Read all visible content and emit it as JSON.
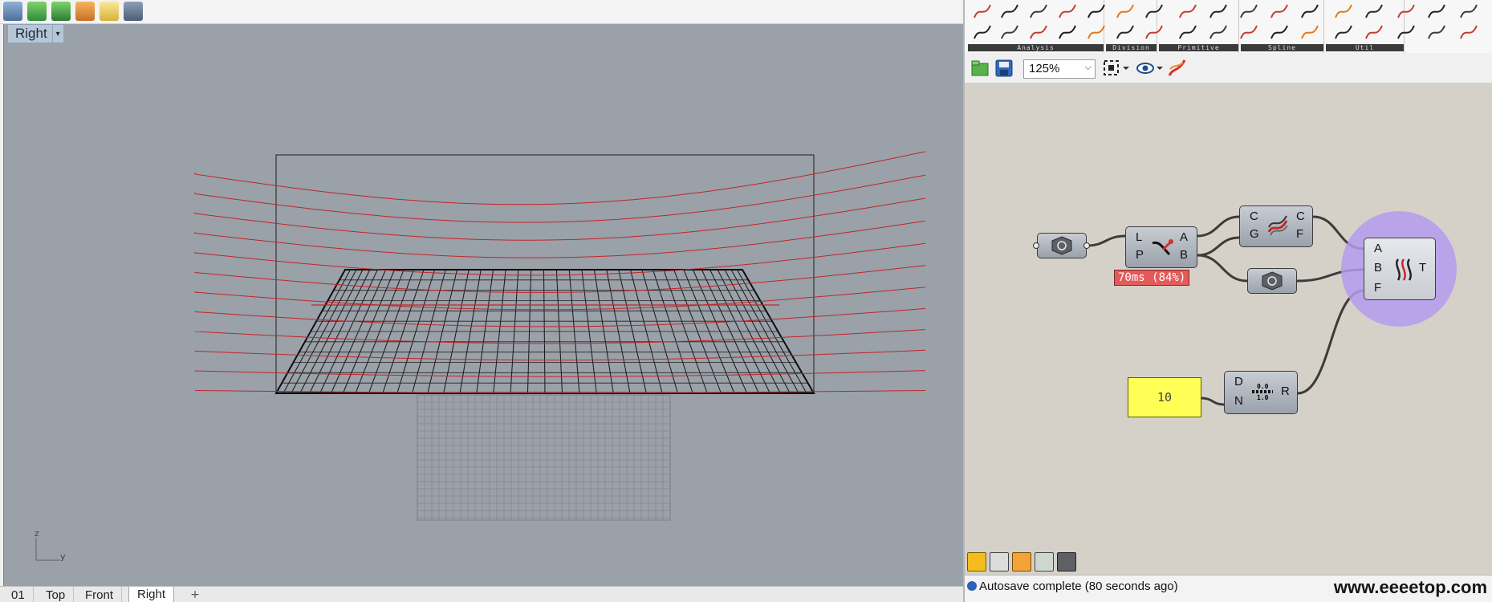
{
  "viewport": {
    "active_view": "Right",
    "axis_z": "z",
    "axis_y": "y"
  },
  "view_tabs": {
    "tabs": [
      "01",
      "Top",
      "Front",
      "Right"
    ],
    "active": "Right",
    "add": "+"
  },
  "grasshopper": {
    "ribbon_groups": [
      "Analysis",
      "Division",
      "Primitive",
      "Spline",
      "Util"
    ],
    "zoom": "125%",
    "timing_badge": "70ms (84%)",
    "panel_value": "10",
    "components": {
      "eval_curve": {
        "inputs": [
          "L",
          "P"
        ],
        "outputs": [
          "A",
          "B"
        ]
      },
      "curve_frames": {
        "inputs": [
          "C",
          "G"
        ],
        "outputs": [
          "C",
          "F"
        ]
      },
      "tween": {
        "inputs": [
          "A",
          "B",
          "F"
        ],
        "outputs": [
          "T"
        ]
      },
      "range": {
        "inputs": [
          "D",
          "N"
        ],
        "outputs": [
          "R"
        ],
        "icon_top": "0.0",
        "icon_bottom": "1.0"
      }
    },
    "status": "Autosave complete (80 seconds ago)",
    "watermark": "www.eeeetop.com"
  },
  "colors": {
    "viewport_bg": "#9aa1a9",
    "curve_red": "#c0262b",
    "canvas_bg": "#d5d1c8",
    "panel_yellow": "#ffff55",
    "badge_red": "#e45a5a",
    "selection_purple": "#b49cf0"
  }
}
